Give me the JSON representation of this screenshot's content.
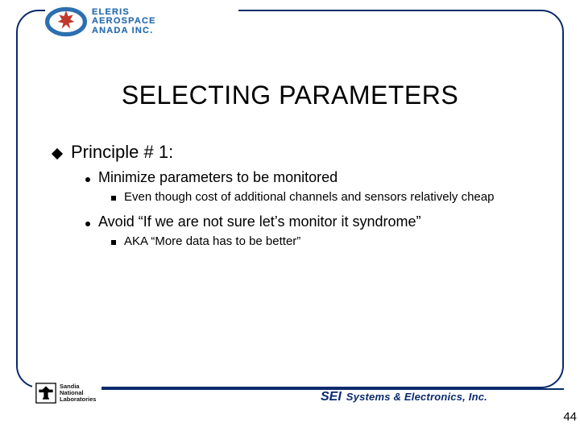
{
  "header": {
    "company_line1": "ELERIS",
    "company_line2": "AEROSPACE",
    "company_line3": "ANADA INC."
  },
  "title": "SELECTING PARAMETERS",
  "bullets": {
    "lvl1": "Principle  # 1:",
    "lvl2a": "Minimize parameters to be monitored",
    "lvl3a": "Even though cost of additional channels and sensors relatively cheap",
    "lvl2b": "Avoid “If we are not sure let’s monitor it syndrome”",
    "lvl3b": "AKA “More data has to be better”"
  },
  "footer": {
    "sandia_line1": "Sandia",
    "sandia_line2": "National",
    "sandia_line3": "Laboratories",
    "sei_abbr": "SEI",
    "sei_full": "Systems & Electronics, Inc."
  },
  "page_number": "44"
}
